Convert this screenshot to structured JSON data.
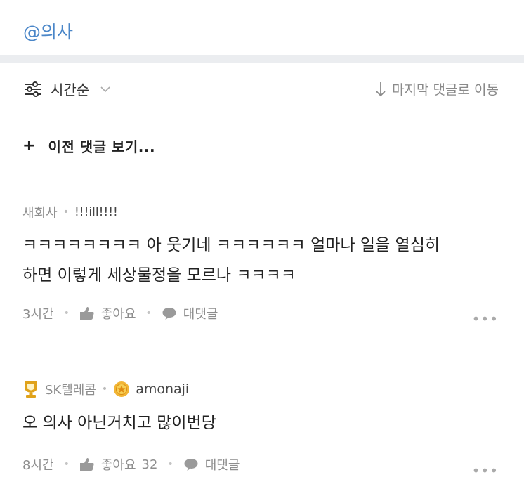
{
  "mention": "@의사",
  "sort_bar": {
    "sort_label": "시간순",
    "jump_label": "마지막 댓글로 이동"
  },
  "prev_comments": {
    "plus": "+",
    "label": "이전 댓글 보기..."
  },
  "comments": [
    {
      "company": "새회사",
      "nickname": "!!!ill!!!!",
      "text_line1": "ㅋㅋㅋㅋㅋㅋㅋㅋ 아 웃기네 ㅋㅋㅋㅋㅋㅋ 얼마나 일을 열심히",
      "text_line2": "하면 이렇게 세상물정을 모르나 ㅋㅋㅋㅋ",
      "time": "3시간",
      "like_label": "좋아요",
      "like_count": "",
      "reply_label": "대댓글",
      "more": "•••"
    },
    {
      "company": "SK텔레콤",
      "company_badge_icon": "trophy-icon",
      "nickname_badge_icon": "gold-medal-icon",
      "nickname": "amonaji",
      "text_line1": "오 의사 아닌거치고 많이번당",
      "time": "8시간",
      "like_label": "좋아요",
      "like_count": "32",
      "reply_label": "대댓글",
      "more": "•••"
    }
  ],
  "colors": {
    "mention": "#4a86c8",
    "meta_gray": "#8e8e8e",
    "band_gray": "#ebedf0",
    "badge_gold": "#e0a21a"
  }
}
